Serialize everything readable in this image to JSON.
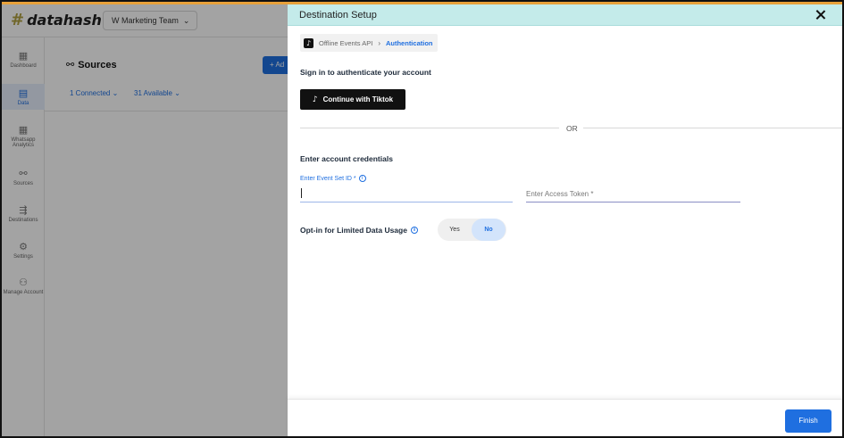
{
  "background_app": {
    "logo_text": "datahash",
    "team_select": "W Marketing Team",
    "page_title": "Sources",
    "add_button": "+ Ad",
    "filters": [
      "1 Connected",
      "31 Available"
    ],
    "sidebar": [
      {
        "label": "Dashboard",
        "icon": "dashboard-icon"
      },
      {
        "label": "Data",
        "icon": "data-icon"
      },
      {
        "label": "Whatsapp Analytics",
        "icon": "whatsapp-analytics-icon"
      },
      {
        "label": "Sources",
        "icon": "sources-icon"
      },
      {
        "label": "Destinations",
        "icon": "destinations-icon"
      },
      {
        "label": "Settings",
        "icon": "settings-icon"
      },
      {
        "label": "Manage Account",
        "icon": "manage-account-icon"
      }
    ]
  },
  "drawer": {
    "title": "Destination Setup",
    "breadcrumb": {
      "item": "Offline Events API",
      "active": "Authentication"
    },
    "sign_in_heading": "Sign in to authenticate your account",
    "tiktok_button": "Continue with Tiktok",
    "or_text": "OR",
    "credentials_heading": "Enter account credentials",
    "event_set_id_label": "Enter Event Set ID *",
    "event_set_id_value": "",
    "access_token_placeholder": "Enter Access Token *",
    "access_token_value": "",
    "opt_in_label": "Opt-in for Limited Data Usage",
    "opt_in_options": [
      "Yes",
      "No"
    ],
    "opt_in_selected": "No",
    "finish_button": "Finish"
  },
  "colors": {
    "header_bg": "#c4ebea",
    "primary": "#1f6fe0",
    "tiktok_black": "#111111"
  }
}
